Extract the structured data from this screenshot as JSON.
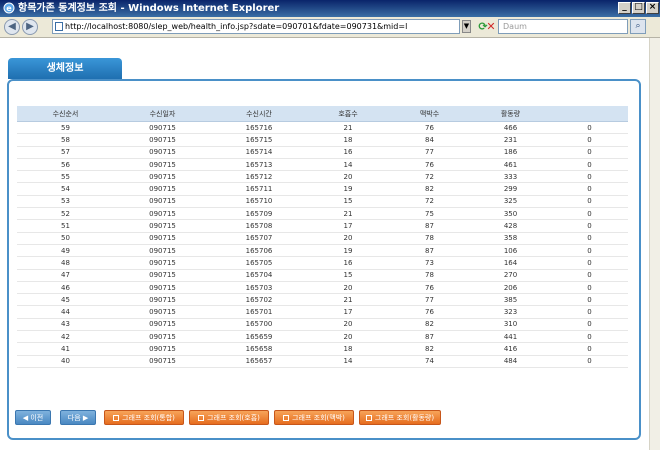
{
  "window": {
    "title": "항목가존 동계정보 조회 - Windows Internet Explorer"
  },
  "browser": {
    "url": "http://localhost:8080/slep_web/health_info.jsp?sdate=090701&fdate=090731&mid=l",
    "search_placeholder": "Daum"
  },
  "tab": {
    "label": "생체정보"
  },
  "table": {
    "headers": [
      "수신순서",
      "수신일자",
      "수신시간",
      "호흡수",
      "맥박수",
      "활동량",
      ""
    ],
    "rows": [
      [
        "59",
        "090715",
        "165716",
        "21",
        "76",
        "466",
        "0"
      ],
      [
        "58",
        "090715",
        "165715",
        "18",
        "84",
        "231",
        "0"
      ],
      [
        "57",
        "090715",
        "165714",
        "16",
        "77",
        "186",
        "0"
      ],
      [
        "56",
        "090715",
        "165713",
        "14",
        "76",
        "461",
        "0"
      ],
      [
        "55",
        "090715",
        "165712",
        "20",
        "72",
        "333",
        "0"
      ],
      [
        "54",
        "090715",
        "165711",
        "19",
        "82",
        "299",
        "0"
      ],
      [
        "53",
        "090715",
        "165710",
        "15",
        "72",
        "325",
        "0"
      ],
      [
        "52",
        "090715",
        "165709",
        "21",
        "75",
        "350",
        "0"
      ],
      [
        "51",
        "090715",
        "165708",
        "17",
        "87",
        "428",
        "0"
      ],
      [
        "50",
        "090715",
        "165707",
        "20",
        "78",
        "358",
        "0"
      ],
      [
        "49",
        "090715",
        "165706",
        "19",
        "87",
        "106",
        "0"
      ],
      [
        "48",
        "090715",
        "165705",
        "16",
        "73",
        "164",
        "0"
      ],
      [
        "47",
        "090715",
        "165704",
        "15",
        "78",
        "270",
        "0"
      ],
      [
        "46",
        "090715",
        "165703",
        "20",
        "76",
        "206",
        "0"
      ],
      [
        "45",
        "090715",
        "165702",
        "21",
        "77",
        "385",
        "0"
      ],
      [
        "44",
        "090715",
        "165701",
        "17",
        "76",
        "323",
        "0"
      ],
      [
        "43",
        "090715",
        "165700",
        "20",
        "82",
        "310",
        "0"
      ],
      [
        "42",
        "090715",
        "165659",
        "20",
        "87",
        "441",
        "0"
      ],
      [
        "41",
        "090715",
        "165658",
        "18",
        "82",
        "416",
        "0"
      ],
      [
        "40",
        "090715",
        "165657",
        "14",
        "74",
        "484",
        "0"
      ]
    ]
  },
  "buttons": {
    "prev": "◀ 이전",
    "next": "다음 ▶",
    "graph_all": "그래프 조회(통합)",
    "graph_breath": "그래프 조회(호흡)",
    "graph_pulse": "그래프 조회(맥박)",
    "graph_activity": "그래프 조회(활동량)"
  }
}
